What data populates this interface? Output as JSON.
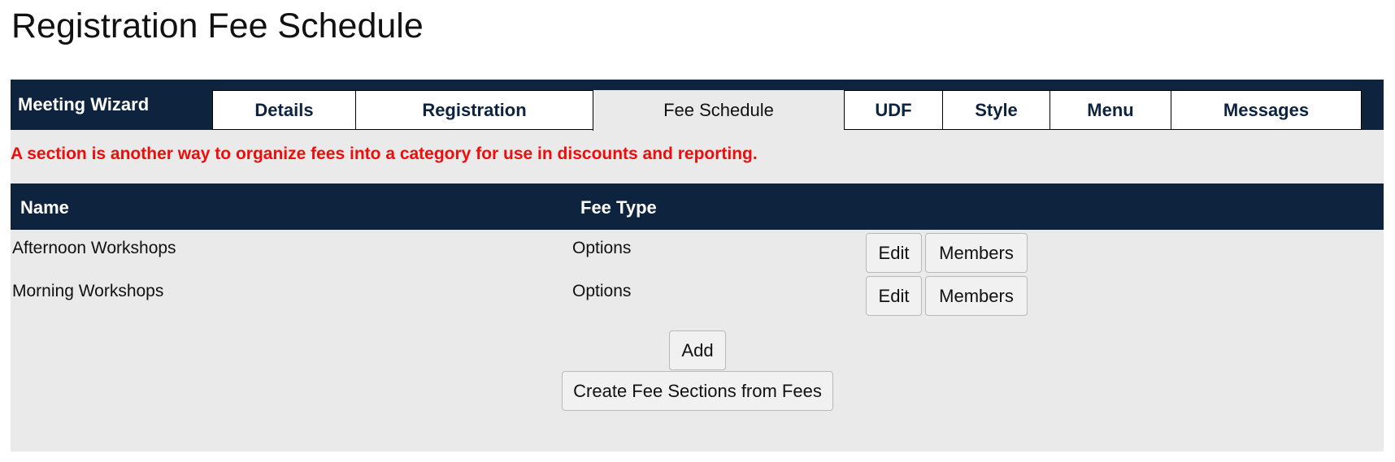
{
  "page": {
    "title": "Registration Fee Schedule"
  },
  "wizard": {
    "label": "Meeting Wizard",
    "tabs": [
      {
        "label": "Details"
      },
      {
        "label": "Registration"
      },
      {
        "label": "Fee Schedule",
        "active": true
      },
      {
        "label": "UDF"
      },
      {
        "label": "Style"
      },
      {
        "label": "Menu"
      },
      {
        "label": "Messages"
      }
    ]
  },
  "notice": "A section is another way to organize fees into a category for use in discounts and reporting.",
  "table": {
    "columns": {
      "name": "Name",
      "fee_type": "Fee Type"
    },
    "rows": [
      {
        "name": "Afternoon Workshops",
        "fee_type": "Options",
        "edit_label": "Edit",
        "members_label": "Members"
      },
      {
        "name": "Morning Workshops",
        "fee_type": "Options",
        "edit_label": "Edit",
        "members_label": "Members"
      }
    ]
  },
  "actions": {
    "add_label": "Add",
    "create_label": "Create Fee Sections from Fees"
  },
  "colors": {
    "header_bg": "#0e233d",
    "panel_bg": "#eaeaea",
    "notice_text": "#ee0d0d"
  }
}
